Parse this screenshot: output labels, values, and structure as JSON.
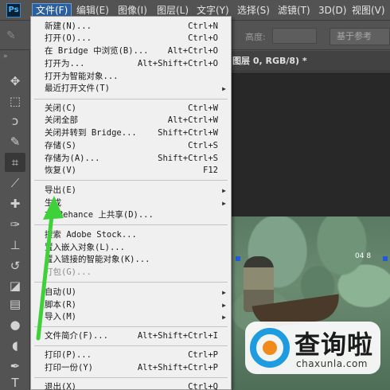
{
  "app": {
    "logo": "Ps"
  },
  "menubar": {
    "items": [
      {
        "label": "文件(F)",
        "active": true
      },
      {
        "label": "编辑(E)"
      },
      {
        "label": "图像(I)"
      },
      {
        "label": "图层(L)"
      },
      {
        "label": "文字(Y)"
      },
      {
        "label": "选择(S)"
      },
      {
        "label": "滤镜(T)"
      },
      {
        "label": "3D(D)"
      },
      {
        "label": "视图(V)"
      }
    ]
  },
  "options": {
    "height_label": "高度:",
    "reference_button": "基于参考"
  },
  "document": {
    "tab_title": "图层 0, RGB/8) *",
    "zoom": "04 8"
  },
  "file_menu": {
    "items": [
      {
        "label": "新建(N)...",
        "shortcut": "Ctrl+N"
      },
      {
        "label": "打开(O)...",
        "shortcut": "Ctrl+O"
      },
      {
        "label": "在 Bridge 中浏览(B)...",
        "shortcut": "Alt+Ctrl+O"
      },
      {
        "label": "打开为...",
        "shortcut": "Alt+Shift+Ctrl+O"
      },
      {
        "label": "打开为智能对象...",
        "shortcut": ""
      },
      {
        "label": "最近打开文件(T)",
        "shortcut": "",
        "submenu": true
      },
      {
        "label": "关闭(C)",
        "shortcut": "Ctrl+W"
      },
      {
        "label": "关闭全部",
        "shortcut": "Alt+Ctrl+W"
      },
      {
        "label": "关闭并转到 Bridge...",
        "shortcut": "Shift+Ctrl+W"
      },
      {
        "label": "存储(S)",
        "shortcut": "Ctrl+S"
      },
      {
        "label": "存储为(A)...",
        "shortcut": "Shift+Ctrl+S"
      },
      {
        "label": "恢复(V)",
        "shortcut": "F12"
      },
      {
        "label": "导出(E)",
        "shortcut": "",
        "submenu": true
      },
      {
        "label": "生成",
        "shortcut": "",
        "submenu": true
      },
      {
        "label": "在 Behance 上共享(D)...",
        "shortcut": ""
      },
      {
        "label": "搜索 Adobe Stock...",
        "shortcut": ""
      },
      {
        "label": "置入嵌入对象(L)...",
        "shortcut": ""
      },
      {
        "label": "置入链接的智能对象(K)...",
        "shortcut": ""
      },
      {
        "label": "打包(G)...",
        "shortcut": "",
        "disabled": true
      },
      {
        "label": "自动(U)",
        "shortcut": "",
        "submenu": true
      },
      {
        "label": "脚本(R)",
        "shortcut": "",
        "submenu": true
      },
      {
        "label": "导入(M)",
        "shortcut": "",
        "submenu": true
      },
      {
        "label": "文件简介(F)...",
        "shortcut": "Alt+Shift+Ctrl+I"
      },
      {
        "label": "打印(P)...",
        "shortcut": "Ctrl+P"
      },
      {
        "label": "打印一份(Y)",
        "shortcut": "Alt+Shift+Ctrl+P"
      },
      {
        "label": "退出(X)",
        "shortcut": "Ctrl+Q"
      }
    ],
    "submenu_arrow": "▶"
  },
  "toolbar": {
    "tools": [
      {
        "icon": "move-icon",
        "glyph": "✥"
      },
      {
        "icon": "marquee-icon",
        "glyph": "⬚"
      },
      {
        "icon": "lasso-icon",
        "glyph": "ↄ"
      },
      {
        "icon": "quick-select-icon",
        "glyph": "✎"
      },
      {
        "icon": "crop-icon",
        "glyph": "⌗"
      },
      {
        "icon": "eyedropper-icon",
        "glyph": "⟋"
      },
      {
        "icon": "healing-brush-icon",
        "glyph": "✚"
      },
      {
        "icon": "brush-icon",
        "glyph": "✑"
      },
      {
        "icon": "clone-stamp-icon",
        "glyph": "⊥"
      },
      {
        "icon": "history-brush-icon",
        "glyph": "↺"
      },
      {
        "icon": "eraser-icon",
        "glyph": "◪"
      },
      {
        "icon": "gradient-icon",
        "glyph": "▤"
      },
      {
        "icon": "blur-icon",
        "glyph": "●"
      },
      {
        "icon": "dodge-icon",
        "glyph": "◖"
      },
      {
        "icon": "pen-icon",
        "glyph": "✒"
      },
      {
        "icon": "type-icon",
        "glyph": "T"
      }
    ]
  },
  "watermark": {
    "title": "查询啦",
    "url": "chaxunla.com"
  },
  "colors": {
    "menu_highlight": "#2b5f9e",
    "annotation_arrow": "#3fd13a",
    "watermark_blue": "#1f9ce0",
    "watermark_orange": "#f08a1c"
  }
}
